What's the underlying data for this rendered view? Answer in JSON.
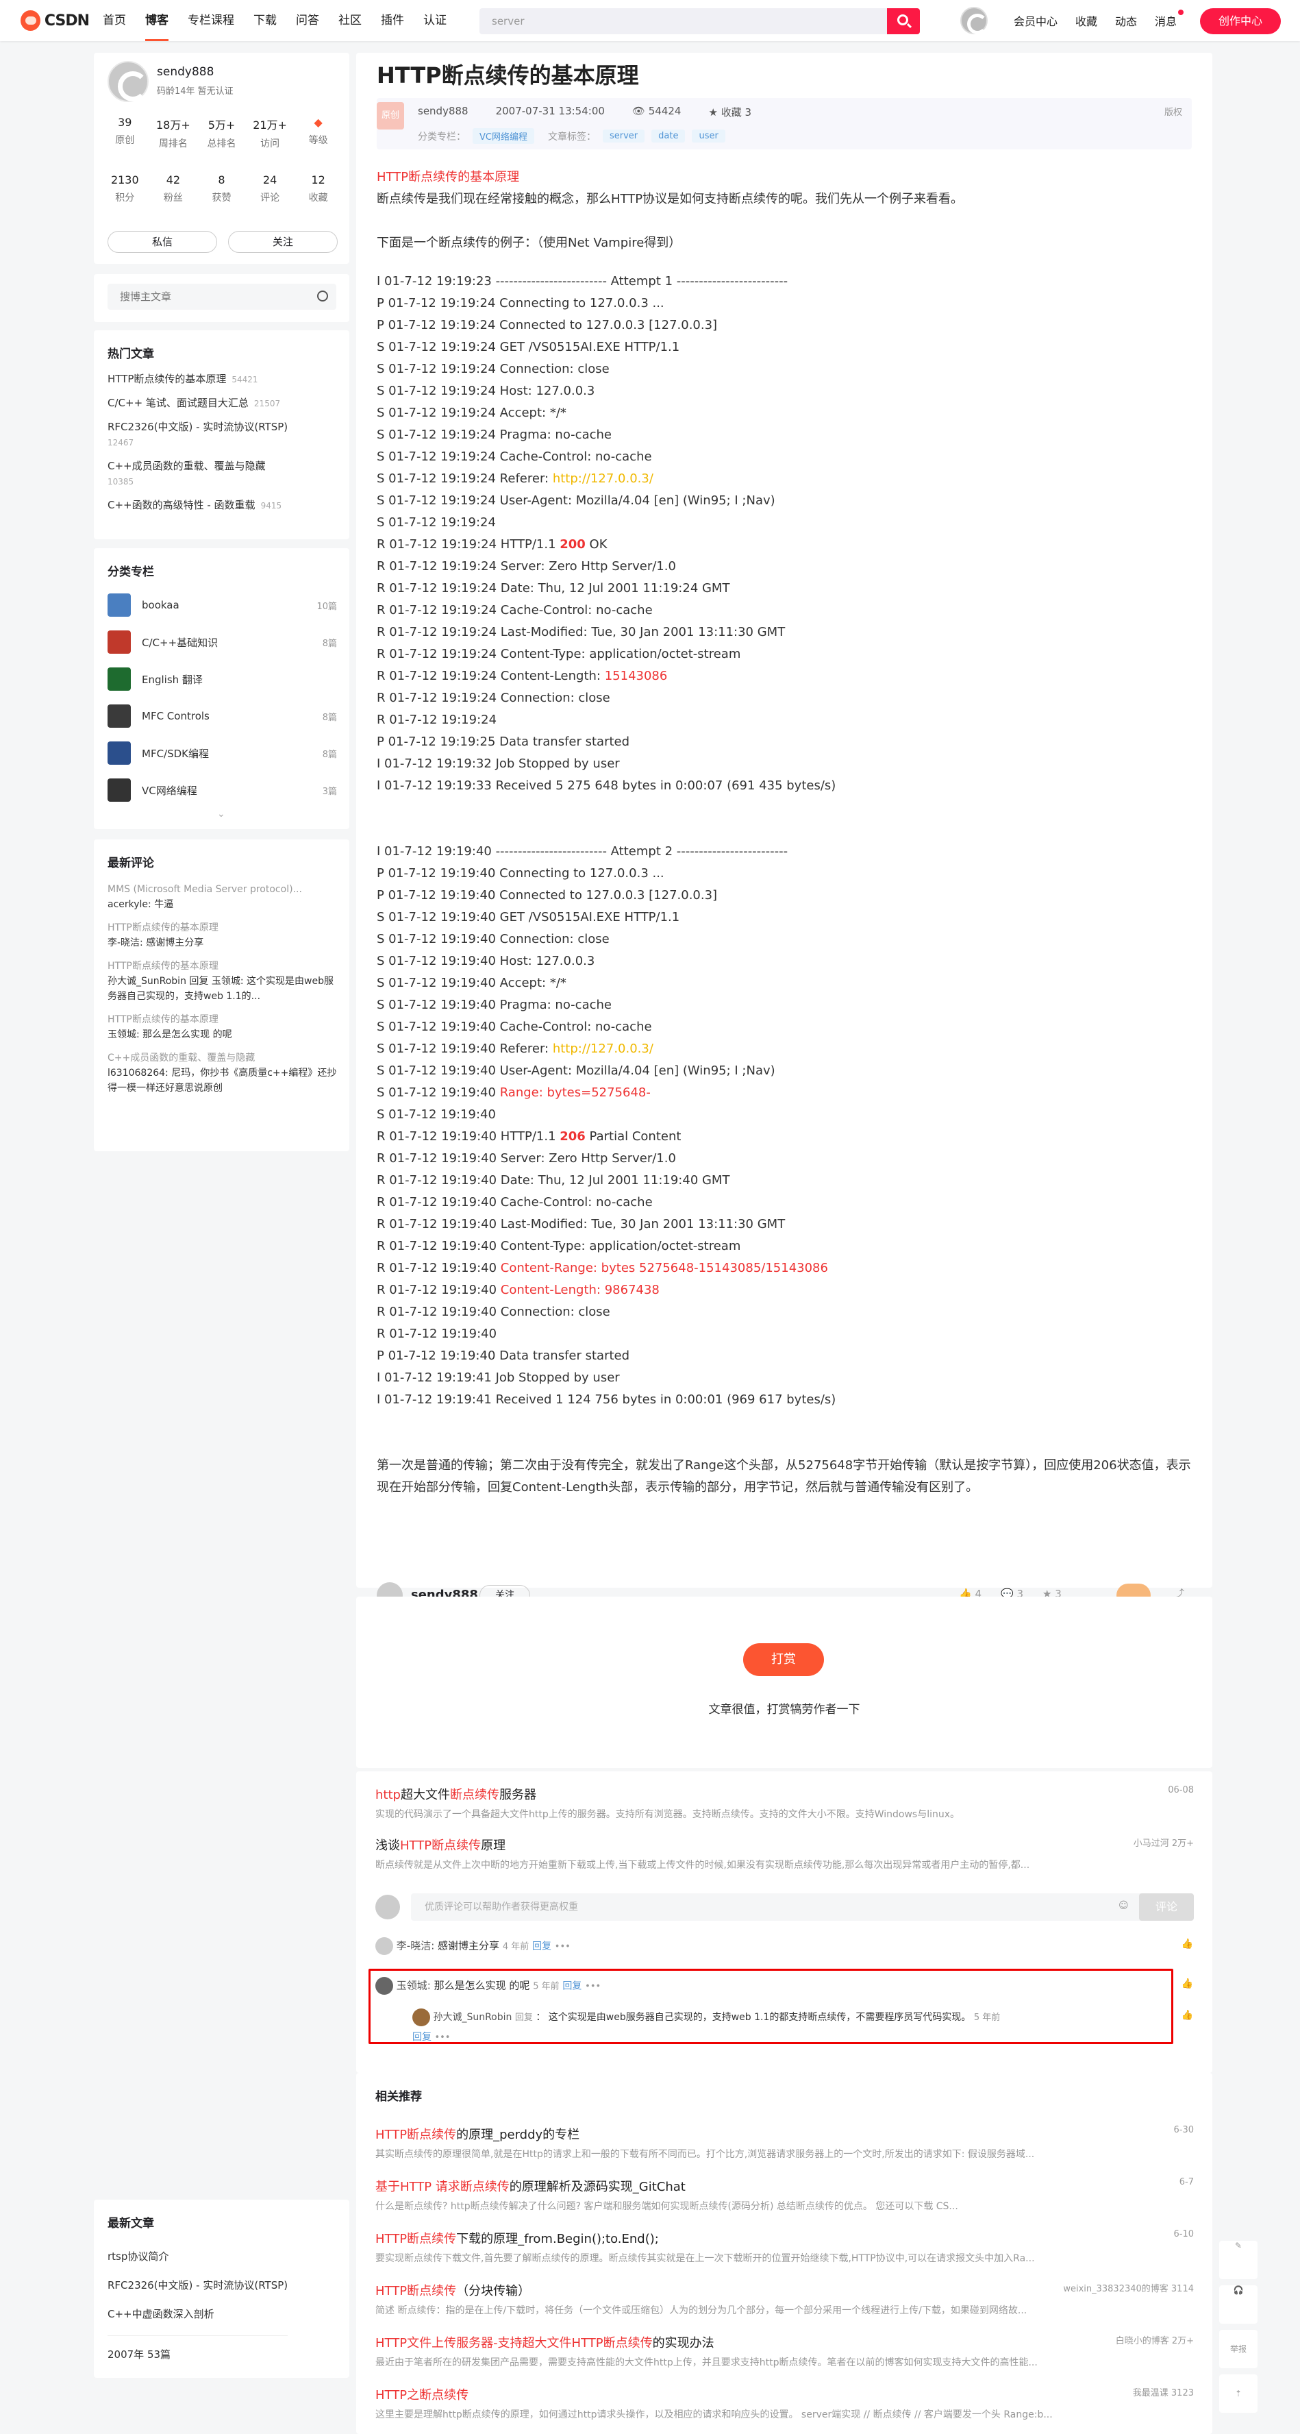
{
  "nav": {
    "logo": "CSDN",
    "items": [
      "首页",
      "博客",
      "专栏课程",
      "下载",
      "问答",
      "社区",
      "插件",
      "认证"
    ],
    "search_placeholder": "server",
    "links": [
      "会员中心",
      "收藏",
      "动态",
      "消息"
    ],
    "create": "创作中心"
  },
  "profile": {
    "name": "sendy888",
    "meta": "码龄14年  暂无认证",
    "stats1": [
      {
        "v": "39",
        "l": "原创"
      },
      {
        "v": "18万+",
        "l": "周排名"
      },
      {
        "v": "5万+",
        "l": "总排名"
      },
      {
        "v": "21万+",
        "l": "访问"
      },
      {
        "v": "",
        "l": "等级"
      }
    ],
    "stats2": [
      {
        "v": "2130",
        "l": "积分"
      },
      {
        "v": "42",
        "l": "粉丝"
      },
      {
        "v": "8",
        "l": "获赞"
      },
      {
        "v": "24",
        "l": "评论"
      },
      {
        "v": "12",
        "l": "收藏"
      }
    ],
    "msg": "私信",
    "follow": "关注"
  },
  "blogsearch": "搜博主文章",
  "hot": {
    "title": "热门文章",
    "items": [
      {
        "t": "HTTP断点续传的基本原理",
        "c": "54421"
      },
      {
        "t": "C/C++ 笔试、面试题目大汇总",
        "c": "21507"
      },
      {
        "t": "RFC2326(中文版) - 实时流协议(RTSP)",
        "c": "12467"
      },
      {
        "t": "C++成员函数的重载、覆盖与隐藏",
        "c": "10385"
      },
      {
        "t": "C++函数的高级特性 - 函数重载",
        "c": "9415"
      }
    ]
  },
  "columns": {
    "title": "分类专栏",
    "items": [
      {
        "n": "bookaa",
        "c": "10篇",
        "color": "#4a7fc1"
      },
      {
        "n": "C/C++基础知识",
        "c": "8篇",
        "color": "#c0392b"
      },
      {
        "n": "English 翻译",
        "c": "",
        "color": "#1e6b2f"
      },
      {
        "n": "MFC Controls",
        "c": "8篇",
        "color": "#3a3a3a"
      },
      {
        "n": "MFC/SDK编程",
        "c": "8篇",
        "color": "#2b4f8c"
      },
      {
        "n": "VC网络编程",
        "c": "3篇",
        "color": "#333"
      }
    ]
  },
  "recent": {
    "title": "最新评论",
    "items": [
      {
        "t": "MMS (Microsoft Media Server protocol)...",
        "c": "acerkyle: 牛逼"
      },
      {
        "t": "HTTP断点续传的基本原理",
        "c": "李-晓洁: 感谢博主分享"
      },
      {
        "t": "HTTP断点续传的基本原理",
        "c": "孙大诚_SunRobin 回复 玉领城: 这个实现是由web服务器自己实现的，支持web 1.1的..."
      },
      {
        "t": "HTTP断点续传的基本原理",
        "c": "玉领城: 那么是怎么实现 的呢"
      },
      {
        "t": "C++成员函数的重载、覆盖与隐藏",
        "c": "l631068264: 尼玛，你抄书《高质量c++编程》还抄得一模一样还好意思说原创"
      }
    ]
  },
  "newart": {
    "title": "最新文章",
    "items": [
      "rtsp协议简介",
      "RFC2326(中文版) - 实时流协议(RTSP)",
      "C++中虚函数深入剖析"
    ],
    "year": "2007年 53篇"
  },
  "article": {
    "title": "HTTP断点续传的基本原理",
    "badge": "原创",
    "author": "sendy888",
    "date": "2007-07-31 13:54:00",
    "views": "54424",
    "fav": "收藏 3",
    "copyright": "版权",
    "cat_label": "分类专栏：",
    "cat": "VC网络编程",
    "tags_label": "文章标签：",
    "tags": [
      "server",
      "date",
      "user"
    ],
    "intro_red": "HTTP断点续传的基本原理",
    "intro": "断点续传是我们现在经常接触的概念，那么HTTP协议是如何支持断点续传的呢。我们先从一个例子来看看。",
    "example": "下面是一个断点续传的例子：（使用Net Vampire得到）",
    "summary": "第一次是普通的传输；第二次由于没有传完全，就发出了Range这个头部，从5275648字节开始传输（默认是按字节算），回应使用206状态值，表示现在开始部分传输，回复Content-Length头部，表示传输的部分，用字节记，然后就与普通传输没有区别了。"
  },
  "log1": [
    [
      "I 01-7-12 19:19:23 ------------------------- Attempt 1 -------------------------"
    ],
    [
      "P 01-7-12 19:19:24 Connecting to 127.0.0.3 ..."
    ],
    [
      "P 01-7-12 19:19:24 Connected to 127.0.0.3 [127.0.0.3]"
    ],
    [
      "S 01-7-12 19:19:24 GET /VS0515AI.EXE HTTP/1.1"
    ],
    [
      "S 01-7-12 19:19:24 Connection: close"
    ],
    [
      "S 01-7-12 19:19:24 Host: 127.0.0.3"
    ],
    [
      "S 01-7-12 19:19:24 Accept: */*"
    ],
    [
      "S 01-7-12 19:19:24 Pragma: no-cache"
    ],
    [
      "S 01-7-12 19:19:24 Cache-Control: no-cache"
    ],
    [
      "S 01-7-12 19:19:24 Referer: ",
      "http://127.0.0.3/",
      "yel"
    ],
    [
      "S 01-7-12 19:19:24 User-Agent: Mozilla/4.04 [en] (Win95; I ;Nav)"
    ],
    [
      "S 01-7-12 19:19:24"
    ],
    [
      "R 01-7-12 19:19:24 HTTP/1.1 ",
      "200",
      " OK",
      "redb"
    ],
    [
      "R 01-7-12 19:19:24 Server: Zero Http Server/1.0"
    ],
    [
      "R 01-7-12 19:19:24 Date: Thu, 12 Jul 2001 11:19:24 GMT"
    ],
    [
      "R 01-7-12 19:19:24 Cache-Control: no-cache"
    ],
    [
      "R 01-7-12 19:19:24 Last-Modified: Tue, 30 Jan 2001 13:11:30 GMT"
    ],
    [
      "R 01-7-12 19:19:24 Content-Type: application/octet-stream"
    ],
    [
      "R 01-7-12 19:19:24 Content-Length: ",
      "15143086",
      "red"
    ],
    [
      "R 01-7-12 19:19:24 Connection: close"
    ],
    [
      "R 01-7-12 19:19:24"
    ],
    [
      "P 01-7-12 19:19:25 Data transfer started"
    ],
    [
      "I 01-7-12 19:19:32 Job Stopped by user"
    ],
    [
      "I 01-7-12 19:19:33 Received 5 275 648 bytes in 0:00:07 (691 435 bytes/s)"
    ]
  ],
  "log2": [
    [
      "I 01-7-12 19:19:40 ------------------------- Attempt 2 -------------------------"
    ],
    [
      "P 01-7-12 19:19:40 Connecting to 127.0.0.3 ..."
    ],
    [
      "P 01-7-12 19:19:40 Connected to 127.0.0.3 [127.0.0.3]"
    ],
    [
      "S 01-7-12 19:19:40 GET /VS0515AI.EXE HTTP/1.1"
    ],
    [
      "S 01-7-12 19:19:40 Connection: close"
    ],
    [
      "S 01-7-12 19:19:40 Host: 127.0.0.3"
    ],
    [
      "S 01-7-12 19:19:40 Accept: */*"
    ],
    [
      "S 01-7-12 19:19:40 Pragma: no-cache"
    ],
    [
      "S 01-7-12 19:19:40 Cache-Control: no-cache"
    ],
    [
      "S 01-7-12 19:19:40 Referer: ",
      "http://127.0.0.3/",
      "yel"
    ],
    [
      "S 01-7-12 19:19:40 User-Agent: Mozilla/4.04 [en] (Win95; I ;Nav)"
    ],
    [
      "S 01-7-12 19:19:40 ",
      "Range: bytes=5275648-",
      "red"
    ],
    [
      "S 01-7-12 19:19:40"
    ],
    [
      "R 01-7-12 19:19:40 HTTP/1.1 ",
      "206",
      " Partial Content",
      "redb"
    ],
    [
      "R 01-7-12 19:19:40 Server: Zero Http Server/1.0"
    ],
    [
      "R 01-7-12 19:19:40 Date: Thu, 12 Jul 2001 11:19:40 GMT"
    ],
    [
      "R 01-7-12 19:19:40 Cache-Control: no-cache"
    ],
    [
      "R 01-7-12 19:19:40 Last-Modified: Tue, 30 Jan 2001 13:11:30 GMT"
    ],
    [
      "R 01-7-12 19:19:40 Content-Type: application/octet-stream"
    ],
    [
      "R 01-7-12 19:19:40 ",
      "Content-Range: bytes 5275648-15143085/15143086",
      "red"
    ],
    [
      "R 01-7-12 19:19:40 ",
      "Content-Length: 9867438",
      "red"
    ],
    [
      "R 01-7-12 19:19:40 Connection: close"
    ],
    [
      "R 01-7-12 19:19:40"
    ],
    [
      "P 01-7-12 19:19:40 Data transfer started"
    ],
    [
      "I 01-7-12 19:19:41 Job Stopped by user"
    ],
    [
      "I 01-7-12 19:19:41 Received 1 124 756 bytes in 0:00:01 (969 617 bytes/s)"
    ]
  ],
  "toolbar": {
    "author": "sendy888",
    "follow": "关注",
    "likes": "4",
    "comments": "3",
    "stars": "3"
  },
  "tip": {
    "btn": "打赏",
    "text": "文章很值，打赏犒劳作者一下"
  },
  "rel1": [
    {
      "a": "http",
      "b": "超大文件",
      "c": "断点续传",
      "d": "服务器",
      "desc": "实现的代码演示了一个具备超大文件http上传的服务器。支持所有浏览器。支持断点续传。支持的文件大小不限。支持Windows与linux。",
      "r": "06-08"
    },
    {
      "a": "浅谈",
      "b": "HTTP",
      "c": "断点续传",
      "d": "原理",
      "desc": "断点续传就是从文件上次中断的地方开始重新下载或上传,当下载或上传文件的时候,如果没有实现断点续传功能,那么每次出现异常或者用户主动的暂停,都...",
      "r": "小马过河   2万+"
    }
  ],
  "commentbox": {
    "placeholder": "优质评论可以帮助作者获得更高权重",
    "submit": "评论"
  },
  "cmts": [
    {
      "who": "李-晓洁:",
      "text": "感谢博主分享",
      "time": "4 年前",
      "reply": "回复"
    },
    {
      "who": "玉领城:",
      "text": "那么是怎么实现 的呢",
      "time": "5 年前",
      "reply": "回复"
    },
    {
      "who": "孙大诚_SunRobin",
      "tag": "回复",
      "text": "：  这个实现是由web服务器自己实现的，支持web 1.1的都支持断点续传，不需要程序员写代码实现。",
      "time": "5 年前",
      "reply": "回复"
    }
  ],
  "rel2": {
    "title": "相关推荐",
    "items": [
      {
        "t1": "HTTP断点续传",
        "t2": "的原理_perddy的专栏",
        "desc": "其实断点续传的原理很简单,就是在Http的请求上和一般的下载有所不同而已。打个比方,浏览器请求服务器上的一个文时,所发出的请求如下: 假设服务器域...",
        "r": "6-30"
      },
      {
        "t1": "基于HTTP 请求断点续传",
        "t2": "的原理解析及源码实现_GitChat",
        "desc": "什么是断点续传? http断点续传解决了什么问题? 客户端和服务端如何实现断点续传(源码分析) 总结断点续传的优点。 您还可以下载 CS...",
        "r": "6-7"
      },
      {
        "t1": "HTTP断点续传",
        "t2": "下载的原理_from.Begin();to.End();",
        "desc": "要实现断点续传下载文件,首先要了解断点续传的原理。断点续传其实就是在上一次下载断开的位置开始继续下载,HTTP协议中,可以在请求报文头中加入Ra...",
        "r": "6-10"
      },
      {
        "t1": "HTTP断点续传",
        "t2": "（分块传输）",
        "desc": "简述 断点续传：指的是在上传/下载时，将任务（一个文件或压缩包）人为的划分为几个部分，每一个部分采用一个线程进行上传/下载，如果碰到网络故...",
        "r": "weixin_33832340的博客   3114"
      },
      {
        "t1": "HTTP文件上传服务器-支持超大文件HTTP断点续传",
        "t2": "的实现办法",
        "desc": "最近由于笔者所在的研发集团产品需要，需要支持高性能的大文件http上传，并且要求支持http断点续传。笔者在以前的博客如何实现支持大文件的高性能...",
        "r": "白晓小的博客   2万+"
      },
      {
        "t1": "HTTP之断点续传",
        "t2": "",
        "desc": "这里主要是理解http断点续传的原理，如何通过http请求头操作，以及相应的请求和响应头的设置。 server端实现 // 断点续传 // 客户端要发一个头 Range:b...",
        "r": "我最温课   3123"
      }
    ]
  },
  "side": [
    "举报"
  ]
}
